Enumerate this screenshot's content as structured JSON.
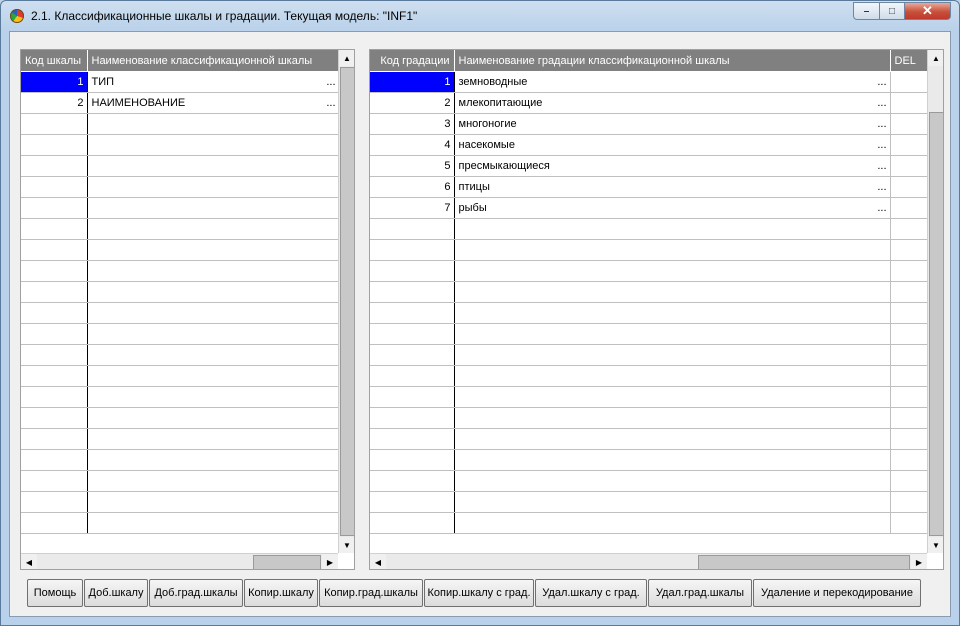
{
  "window": {
    "title": "2.1. Классификационные шкалы и градации. Текущая модель: \"INF1\""
  },
  "scales_grid": {
    "columns": [
      "Код шкалы",
      "Наименование классификационной шкалы"
    ],
    "rows": [
      {
        "code": "1",
        "name": "ТИП",
        "selected": true
      },
      {
        "code": "2",
        "name": "НАИМЕНОВАНИЕ",
        "selected": false
      }
    ],
    "empty_rows": 20,
    "ellipsis": "..."
  },
  "gradations_grid": {
    "columns": [
      "Код градации",
      "Наименование градации классификационной шкалы",
      "DEL"
    ],
    "rows": [
      {
        "code": "1",
        "name": "земноводные",
        "selected": true
      },
      {
        "code": "2",
        "name": "млекопитающие",
        "selected": false
      },
      {
        "code": "3",
        "name": "многоногие",
        "selected": false
      },
      {
        "code": "4",
        "name": "насекомые",
        "selected": false
      },
      {
        "code": "5",
        "name": "пресмыкающиеся",
        "selected": false
      },
      {
        "code": "6",
        "name": "птицы",
        "selected": false
      },
      {
        "code": "7",
        "name": "рыбы",
        "selected": false
      }
    ],
    "empty_rows": 15,
    "ellipsis": "..."
  },
  "buttons": [
    {
      "id": "help-button",
      "label": "Помощь"
    },
    {
      "id": "add-scale-button",
      "label": "Доб.шкалу"
    },
    {
      "id": "add-gradation-button",
      "label": "Доб.град.шкалы"
    },
    {
      "id": "copy-scale-button",
      "label": "Копир.шкалу"
    },
    {
      "id": "copy-gradation-button",
      "label": "Копир.град.шкалы"
    },
    {
      "id": "copy-scale-with-gradations-button",
      "label": "Копир.шкалу с град."
    },
    {
      "id": "delete-scale-with-gradations-button",
      "label": "Удал.шкалу с град."
    },
    {
      "id": "delete-gradation-button",
      "label": "Удал.град.шкалы"
    },
    {
      "id": "delete-and-recode-button",
      "label": "Удаление и перекодирование"
    }
  ],
  "colors": {
    "selection": "#0000ff",
    "header_bg": "#808080",
    "header_text": "#ffffff"
  }
}
